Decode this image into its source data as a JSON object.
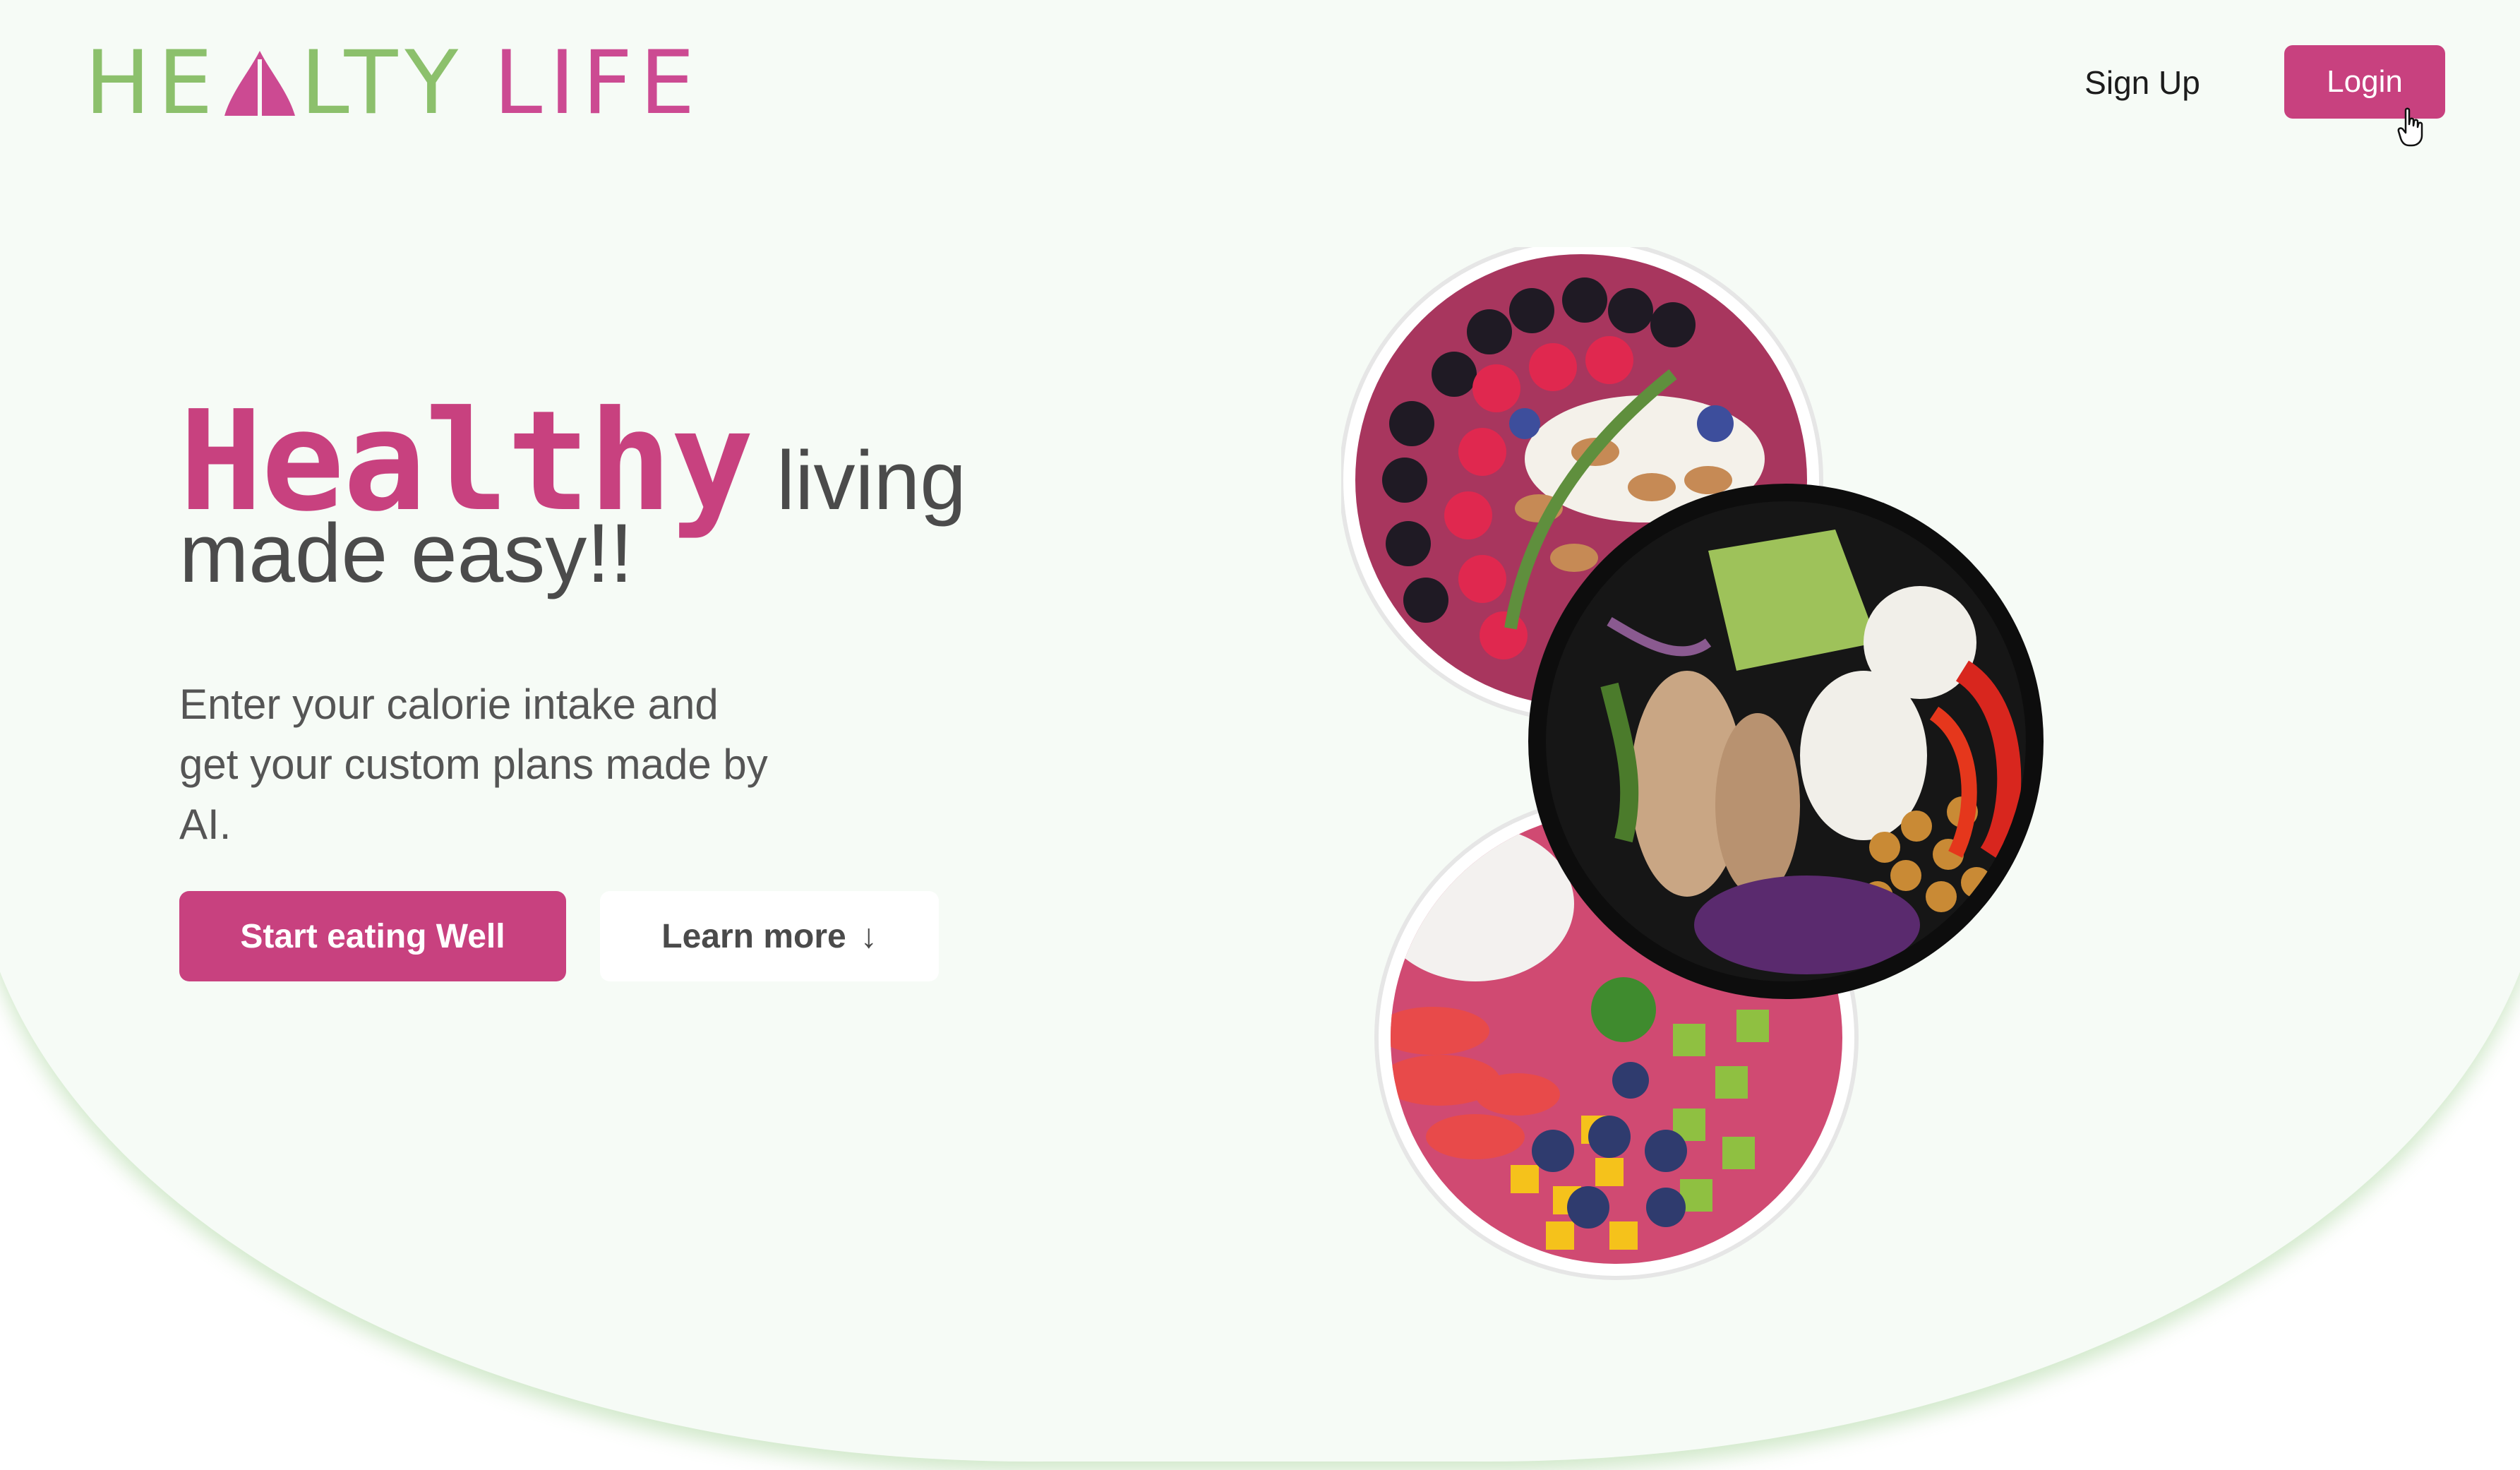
{
  "header": {
    "logo": {
      "part1": "HE",
      "part2": "LTY",
      "part3": "LIFE"
    },
    "signup_label": "Sign Up",
    "login_label": "Login"
  },
  "hero": {
    "headline_accent": "Healthy",
    "headline_rest": "living",
    "headline_line2": "made easy!!",
    "subtext": "Enter your calorie intake and get your custom plans made by AI.",
    "primary_button": "Start eating Well",
    "secondary_button": "Learn more",
    "secondary_button_icon": "arrow-down-icon"
  },
  "colors": {
    "brand_pink": "#c8417f",
    "logo_green": "#8cc06c",
    "hero_background": "#f6fbf6",
    "text_gray": "#4b4b4b"
  }
}
